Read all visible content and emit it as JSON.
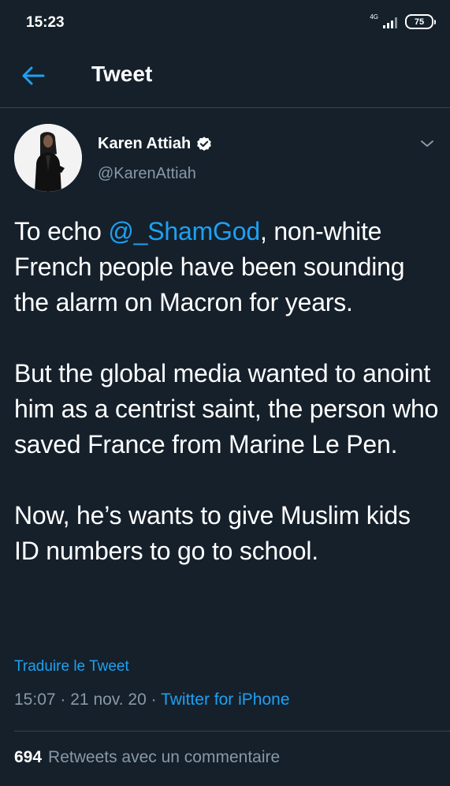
{
  "status_bar": {
    "time": "15:23",
    "network": "4G",
    "battery": "75"
  },
  "header": {
    "title": "Tweet",
    "back_icon": "arrow-left-icon"
  },
  "tweet": {
    "author": {
      "name": "Karen Attiah",
      "handle": "@KarenAttiah",
      "verified": true
    },
    "text": {
      "p1_before": "To echo ",
      "p1_mention": "@_ShamGod",
      "p1_after": ", non-white French people have been sounding the alarm on Macron for years.",
      "p2": "But the global media wanted to anoint him as a centrist saint, the person who saved France from Marine Le Pen.",
      "p3": "Now, he’s wants to give Muslim kids ID numbers to go to school."
    },
    "translate_label": "Traduire le Tweet",
    "time": "15:07",
    "separator": "·",
    "date": "21 nov. 20",
    "source": "Twitter for iPhone",
    "stats": {
      "retweets_count": "694",
      "retweets_label": "Retweets avec un commentaire"
    }
  },
  "colors": {
    "background": "#15202b",
    "accent": "#1da1f2",
    "secondary_text": "#8899a6",
    "border": "#38444d"
  }
}
